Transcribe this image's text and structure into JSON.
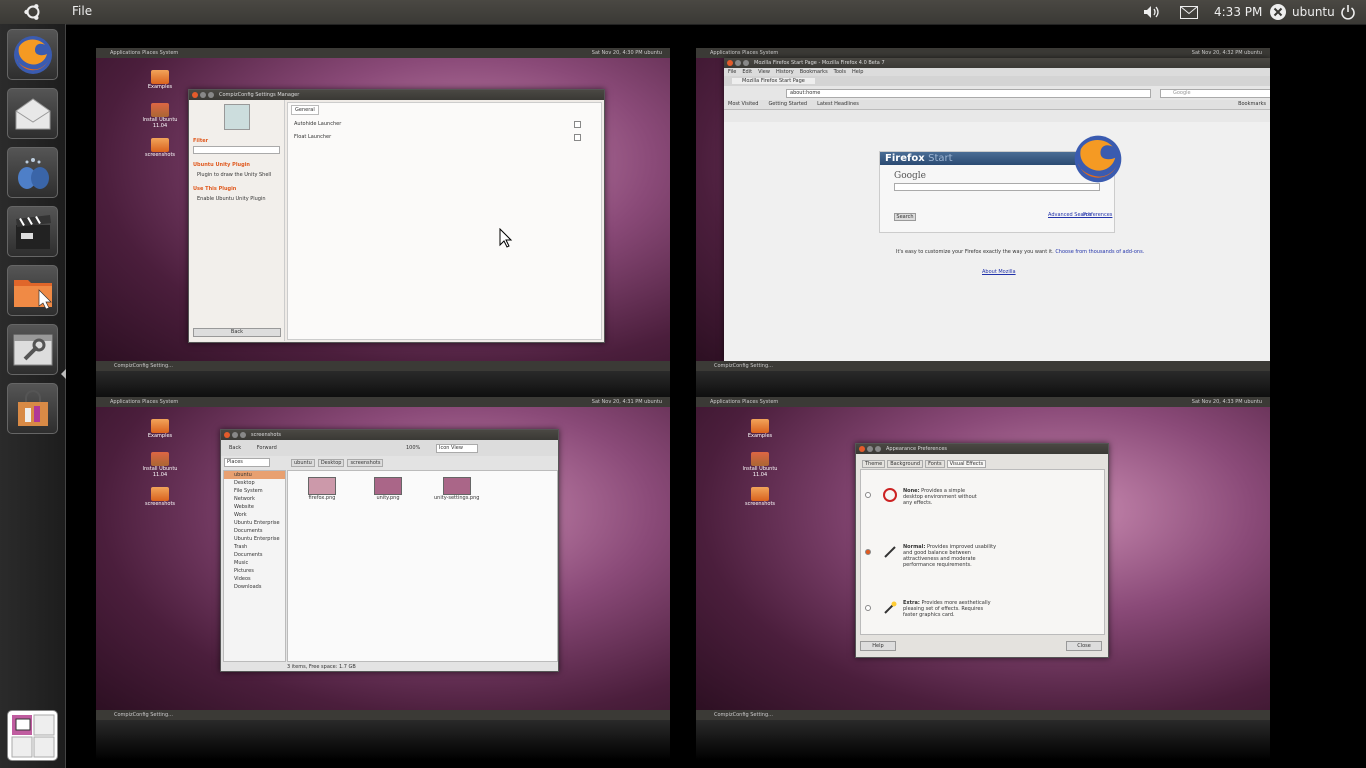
{
  "top_panel": {
    "app_menu": "File",
    "clock": "4:33 PM",
    "user": "ubuntu",
    "icons": [
      "ubuntu-logo-icon",
      "volume-icon",
      "mail-icon",
      "user-icon",
      "power-icon"
    ]
  },
  "launcher": {
    "items": [
      {
        "name": "firefox",
        "icon": "firefox-icon"
      },
      {
        "name": "mail",
        "icon": "mail-icon"
      },
      {
        "name": "empathy",
        "icon": "chat-icon"
      },
      {
        "name": "movie-player",
        "icon": "clapperboard-icon"
      },
      {
        "name": "files",
        "icon": "folder-icon"
      },
      {
        "name": "settings",
        "icon": "wrench-icon"
      },
      {
        "name": "software-center",
        "icon": "shopping-bag-icon"
      }
    ],
    "workspace_switcher_icon": "workspace-switcher-icon"
  },
  "workspaces": [
    {
      "panel_left": "Applications  Places  System",
      "panel_right": "Sat Nov 20, 4:30 PM  ubuntu",
      "taskbar": "CompizConfig Setting...",
      "desktop_icons": [
        "Examples",
        "Install Ubuntu 11.04",
        "screenshots"
      ],
      "window": {
        "title": "CompizConfig Settings Manager",
        "filter_label": "Filter",
        "plugin_title": "Ubuntu Unity Plugin",
        "plugin_desc": "Plugin to draw the Unity Shell",
        "use_title": "Use This Plugin",
        "enable_label": "Enable Ubuntu Unity Plugin",
        "tab": "General",
        "options": [
          "Autohide Launcher",
          "Float Launcher"
        ],
        "back_button": "Back"
      }
    },
    {
      "panel_left": "Applications  Places  System",
      "panel_right": "Sat Nov 20, 4:32 PM  ubuntu",
      "taskbar": "CompizConfig Setting...",
      "window": {
        "title": "Mozilla Firefox Start Page - Mozilla Firefox 4.0 Beta 7",
        "menus": [
          "File",
          "Edit",
          "View",
          "History",
          "Bookmarks",
          "Tools",
          "Help"
        ],
        "tab_title": "Mozilla Firefox Start Page",
        "url": "about:home",
        "search_placeholder": "Google",
        "bookmarks": [
          "Most Visited",
          "Getting Started",
          "Latest Headlines"
        ],
        "bookmarks_right": "Bookmarks",
        "start_title": "Firefox",
        "start_title_suffix": "Start",
        "google_label": "Google",
        "search_button": "Search",
        "links": [
          "Advanced Search",
          "Preferences"
        ],
        "customize_text": "It's easy to customize your Firefox exactly the way you want it.",
        "customize_link": "Choose from thousands of add-ons.",
        "about_link": "About Mozilla"
      }
    },
    {
      "panel_left": "Applications  Places  System",
      "panel_right": "Sat Nov 20, 4:31 PM  ubuntu",
      "taskbar": "CompizConfig Setting...",
      "desktop_icons": [
        "Examples",
        "Install Ubuntu 11.04",
        "screenshots"
      ],
      "window": {
        "title": "screenshots",
        "toolbar": [
          "Back",
          "Forward"
        ],
        "zoom": "100%",
        "view_mode": "Icon View",
        "places_label": "Places",
        "places": [
          "ubuntu",
          "Desktop",
          "File System",
          "Network",
          "Website",
          "Work",
          "Ubuntu Enterprise",
          "Documents",
          "Ubuntu Enterprise",
          "Trash",
          "Documents",
          "Music",
          "Pictures",
          "Videos",
          "Downloads"
        ],
        "path": [
          "ubuntu",
          "Desktop",
          "screenshots"
        ],
        "files": [
          "firefox.png",
          "unity.png",
          "unity-settings.png"
        ],
        "status": "3 items, Free space: 1.7 GB"
      }
    },
    {
      "panel_left": "Applications  Places  System",
      "panel_right": "Sat Nov 20, 4:33 PM  ubuntu",
      "taskbar": "CompizConfig Setting...",
      "desktop_icons": [
        "Examples",
        "Install Ubuntu 11.04",
        "screenshots"
      ],
      "window": {
        "title": "Appearance Preferences",
        "tabs": [
          "Theme",
          "Background",
          "Fonts",
          "Visual Effects"
        ],
        "options": [
          {
            "label": "None:",
            "desc": "Provides a simple desktop environment without any effects.",
            "selected": false
          },
          {
            "label": "Normal:",
            "desc": "Provides improved usability and good balance between attractiveness and moderate performance requirements.",
            "selected": true
          },
          {
            "label": "Extra:",
            "desc": "Provides more aesthetically pleasing set of effects. Requires faster graphics card.",
            "selected": false
          }
        ],
        "help_button": "Help",
        "close_button": "Close"
      }
    }
  ],
  "colors": {
    "panel": "#3c3b37",
    "accent": "#e05a1f",
    "launcher": "#252525"
  }
}
